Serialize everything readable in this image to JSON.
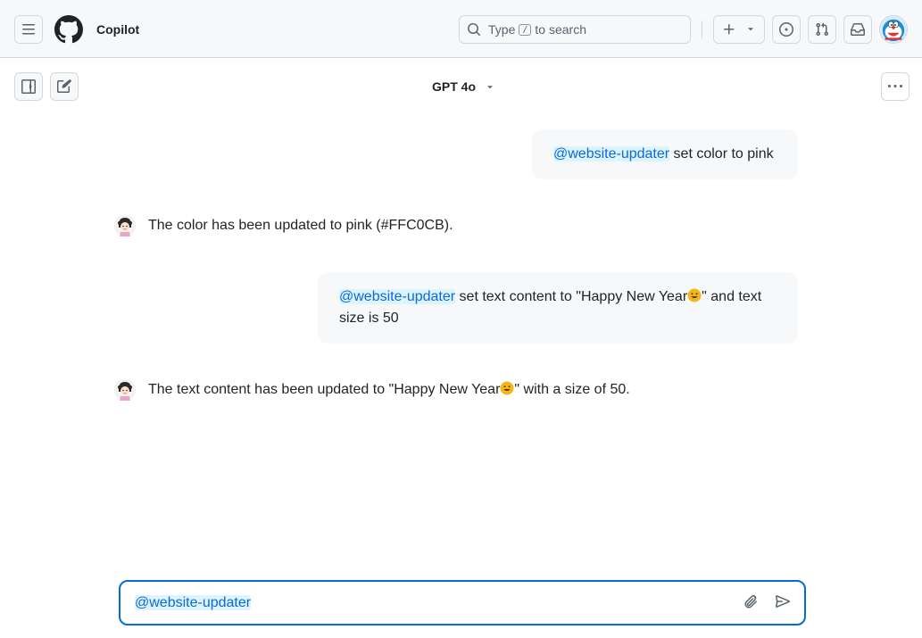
{
  "header": {
    "app_title": "Copilot",
    "search": {
      "prefix": "Type",
      "key": "/",
      "suffix": "to search"
    }
  },
  "toolbar": {
    "model_label": "GPT 4o"
  },
  "conversation": [
    {
      "role": "user",
      "mention": "@website-updater",
      "text": "set color to pink"
    },
    {
      "role": "assistant",
      "text": "The color has been updated to pink (#FFC0CB)."
    },
    {
      "role": "user",
      "mention": "@website-updater",
      "text_before_emoji": "set text content to \"Happy New Year",
      "text_after_emoji": "\" and text size is 50"
    },
    {
      "role": "assistant",
      "text_before_emoji": "The text content has been updated to \"Happy New Year",
      "text_after_emoji": "\" with a size of 50."
    }
  ],
  "composer": {
    "mention": "@website-updater"
  },
  "colors": {
    "accent": "#0969da",
    "mention_bg": "#ddf4ff",
    "bubble_bg": "#f6f8fa",
    "header_bg": "#f6f8fa"
  }
}
